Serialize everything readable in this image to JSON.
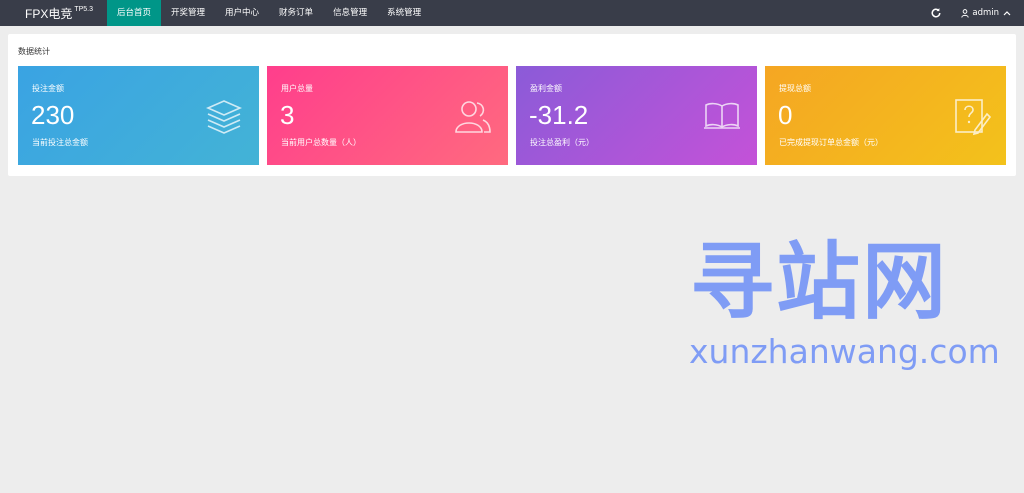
{
  "app": {
    "logo": "FPX电竞",
    "version": "TP5.3"
  },
  "nav": [
    {
      "label": "后台首页",
      "active": true
    },
    {
      "label": "开奖管理"
    },
    {
      "label": "用户中心"
    },
    {
      "label": "财务订单"
    },
    {
      "label": "信息管理"
    },
    {
      "label": "系统管理"
    }
  ],
  "header": {
    "refresh_icon": "refresh-icon",
    "user_icon": "user-icon",
    "username": "admin"
  },
  "panel": {
    "title": "数据统计"
  },
  "cards": [
    {
      "label": "投注金额",
      "value": "230",
      "desc": "当前投注总金额",
      "icon": "layers-icon",
      "color": "#3aa3e3"
    },
    {
      "label": "用户总量",
      "value": "3",
      "desc": "当前用户总数量（人）",
      "icon": "users-icon",
      "color": "#ff3e8c"
    },
    {
      "label": "盈利金额",
      "value": "-31.2",
      "desc": "投注总盈利（元）",
      "icon": "book-icon",
      "color": "#a456d8"
    },
    {
      "label": "提现总额",
      "value": "0",
      "desc": "已完成提现订单总金额（元）",
      "icon": "edit-note-icon",
      "color": "#f3b51f"
    }
  ],
  "watermark": {
    "chinese": "寻站网",
    "latin": "xunzhanwang.com",
    "color": "#7f9cf5"
  }
}
